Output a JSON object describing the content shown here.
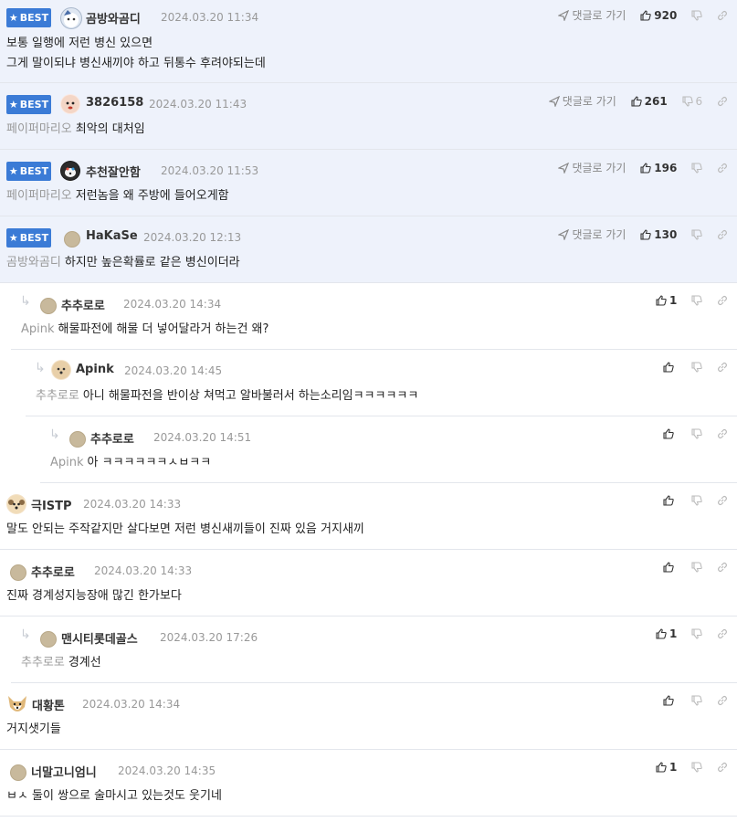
{
  "labels": {
    "best": "BEST",
    "reply_to": "댓글로 가기"
  },
  "comments": [
    {
      "nick": "곰방와곰디",
      "date": "2024.03.20 11:34",
      "likes": "920",
      "dislikes": "",
      "mention": "",
      "text": [
        "보통 일행에 저런 병신 있으면",
        "그게 말이되냐 병신새끼야 하고 뒤통수 후려야되는데"
      ]
    },
    {
      "nick": "3826158",
      "date": "2024.03.20 11:43",
      "likes": "261",
      "dislikes": "6",
      "mention": "페이퍼마리오",
      "text": [
        "최악의 대처임"
      ]
    },
    {
      "nick": "추천잘안함",
      "date": "2024.03.20 11:53",
      "likes": "196",
      "dislikes": "",
      "mention": "페이퍼마리오",
      "text": [
        "저런놈을 왜 주방에 들어오게함"
      ]
    },
    {
      "nick": "HaKaSe",
      "date": "2024.03.20 12:13",
      "likes": "130",
      "dislikes": "",
      "mention": "곰방와곰디",
      "text": [
        "하지만 높은확률로 같은 병신이더라"
      ]
    },
    {
      "nick": "추추로로",
      "date": "2024.03.20 14:34",
      "likes": "1",
      "mention": "Apink",
      "text": [
        "해물파전에 해물 더 넣어달라거 하는건 왜?"
      ]
    },
    {
      "nick": "Apink",
      "date": "2024.03.20 14:45",
      "likes": "",
      "mention": "추추로로",
      "text": [
        "아니 해물파전을 반이상 쳐먹고 알바불러서 하는소리임ㅋㅋㅋㅋㅋㅋ"
      ]
    },
    {
      "nick": "추추로로",
      "date": "2024.03.20 14:51",
      "likes": "",
      "mention": "Apink",
      "text": [
        "아 ㅋㅋㅋㅋㅋㅋㅅㅂㅋㅋ"
      ]
    },
    {
      "nick": "극ISTP",
      "date": "2024.03.20 14:33",
      "likes": "",
      "mention": "",
      "text": [
        "말도 안되는 주작같지만 살다보면 저런 병신새끼들이 진짜 있음 거지새끼"
      ]
    },
    {
      "nick": "추추로로",
      "date": "2024.03.20 14:33",
      "likes": "",
      "mention": "",
      "text": [
        "진짜 경계성지능장애 많긴 한가보다"
      ]
    },
    {
      "nick": "맨시티롯데골스",
      "date": "2024.03.20 17:26",
      "likes": "1",
      "mention": "추추로로",
      "text": [
        "경계선"
      ]
    },
    {
      "nick": "대황톤",
      "date": "2024.03.20 14:34",
      "likes": "",
      "mention": "",
      "text": [
        "거지샛기들"
      ]
    },
    {
      "nick": "너말고니엄니",
      "date": "2024.03.20 14:35",
      "likes": "1",
      "mention": "",
      "text": [
        "ㅂㅅ 둘이 쌍으로 술마시고 있는것도 웃기네"
      ]
    }
  ]
}
